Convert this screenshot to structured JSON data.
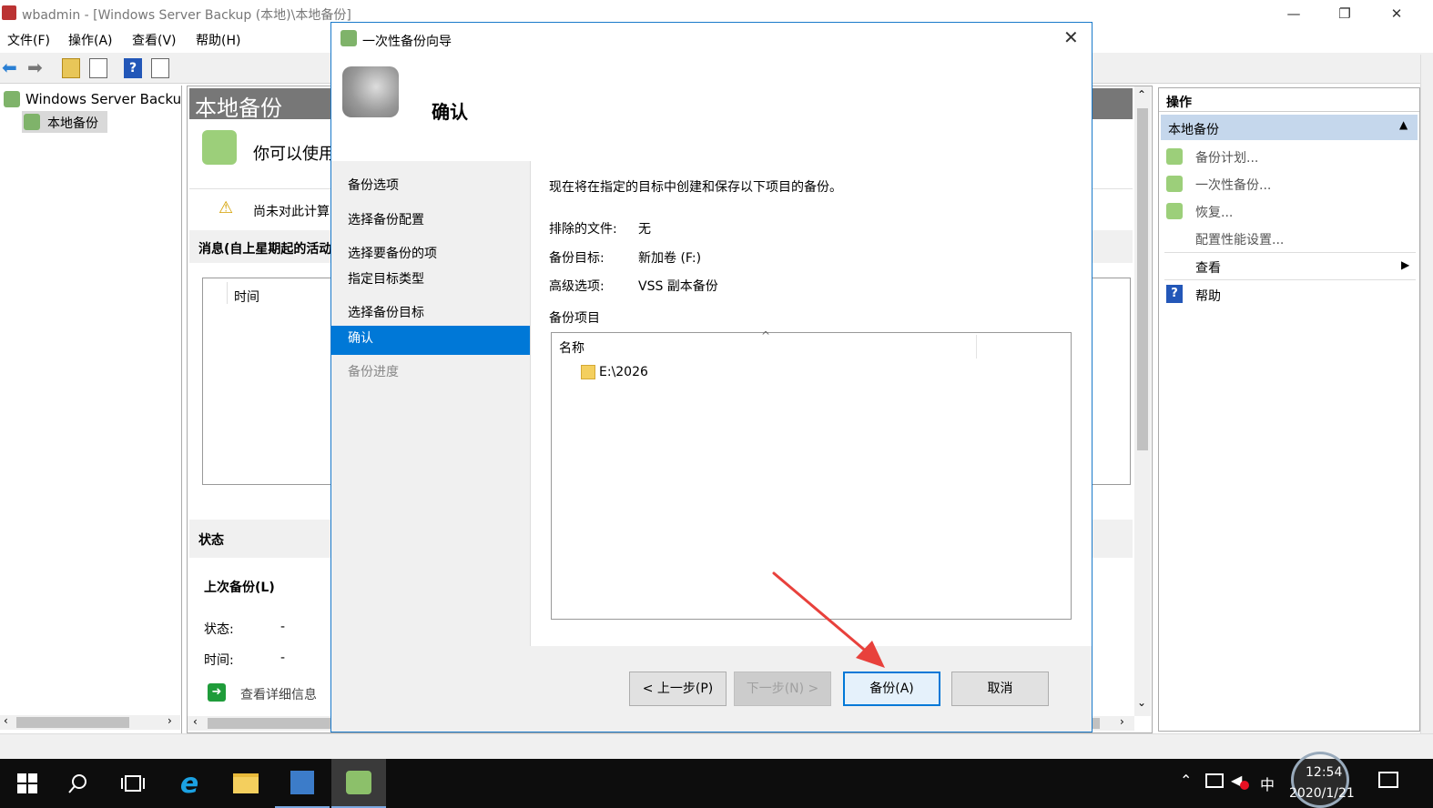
{
  "window": {
    "title": "wbadmin - [Windows Server Backup (本地)\\本地备份]",
    "controls": {
      "minimize": "—",
      "restore": "❐",
      "close": "✕"
    }
  },
  "menu": [
    "文件(F)",
    "操作(A)",
    "查看(V)",
    "帮助(H)"
  ],
  "tree": {
    "root": "Windows Server Backup",
    "child": "本地备份"
  },
  "center": {
    "header": "本地备份",
    "intro": "你可以使用",
    "warning": "尚未对此计算",
    "messages_title": "消息(自上星期起的活动",
    "column_time": "时间",
    "status_title": "状态",
    "last_backup": "上次备份(L)",
    "status_label": "状态:",
    "status_value": "-",
    "time_label": "时间:",
    "time_value": "-",
    "view_details": "查看详细信息"
  },
  "actions": {
    "title": "操作",
    "section": "本地备份",
    "items": [
      "备份计划...",
      "一次性备份...",
      "恢复...",
      "配置性能设置..."
    ],
    "view": "查看",
    "help": "帮助"
  },
  "dialog": {
    "title": "一次性备份向导",
    "header": "确认",
    "nav": [
      {
        "label": "备份选项",
        "state": "normal"
      },
      {
        "label": "选择备份配置",
        "state": "normal"
      },
      {
        "label": "选择要备份的项",
        "state": "normal"
      },
      {
        "label": "指定目标类型",
        "state": "normal"
      },
      {
        "label": "选择备份目标",
        "state": "normal"
      },
      {
        "label": "确认",
        "state": "selected"
      },
      {
        "label": "备份进度",
        "state": "disabled"
      }
    ],
    "description": "现在将在指定的目标中创建和保存以下项目的备份。",
    "excluded_label": "排除的文件:",
    "excluded_value": "无",
    "target_label": "备份目标:",
    "target_value": "新加卷 (F:)",
    "advanced_label": "高级选项:",
    "advanced_value": "VSS 副本备份",
    "items_label": "备份项目",
    "list_header": "名称",
    "list_items": [
      "E:\\2026"
    ],
    "buttons": {
      "prev": "< 上一步(P)",
      "next": "下一步(N) >",
      "backup": "备份(A)",
      "cancel": "取消"
    }
  },
  "taskbar": {
    "ime": "中",
    "time": "12:54",
    "date": "2020/1/21"
  },
  "colors": {
    "accent": "#0078d7",
    "arrow": "#e8413c"
  }
}
